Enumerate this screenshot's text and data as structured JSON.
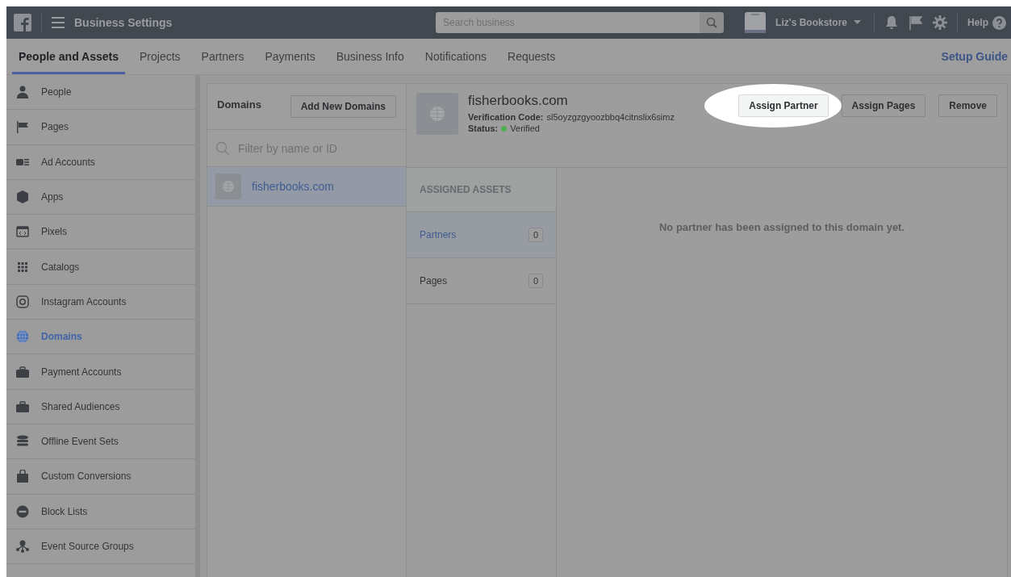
{
  "top_bar": {
    "title": "Business Settings",
    "search": {
      "placeholder": "Search business"
    },
    "account": "Liz's Bookstore",
    "help": "Help"
  },
  "tabs": [
    {
      "label": "People and Assets",
      "selected": true
    },
    {
      "label": "Projects",
      "selected": false
    },
    {
      "label": "Partners",
      "selected": false
    },
    {
      "label": "Payments",
      "selected": false
    },
    {
      "label": "Business Info",
      "selected": false
    },
    {
      "label": "Notifications",
      "selected": false
    },
    {
      "label": "Requests",
      "selected": false
    }
  ],
  "setup_guide": "Setup Guide",
  "sidebar": {
    "items": [
      {
        "label": "People",
        "selected": false
      },
      {
        "label": "Pages",
        "selected": false
      },
      {
        "label": "Ad Accounts",
        "selected": false
      },
      {
        "label": "Apps",
        "selected": false
      },
      {
        "label": "Pixels",
        "selected": false
      },
      {
        "label": "Catalogs",
        "selected": false
      },
      {
        "label": "Instagram Accounts",
        "selected": false
      },
      {
        "label": "Domains",
        "selected": true
      },
      {
        "label": "Payment Accounts",
        "selected": false
      },
      {
        "label": "Shared Audiences",
        "selected": false
      },
      {
        "label": "Offline Event Sets",
        "selected": false
      },
      {
        "label": "Custom Conversions",
        "selected": false
      },
      {
        "label": "Block Lists",
        "selected": false
      },
      {
        "label": "Event Source Groups",
        "selected": false
      }
    ]
  },
  "domains_panel": {
    "title": "Domains",
    "add_button": "Add New Domains",
    "filter": {
      "placeholder": "Filter by name or ID"
    },
    "items": [
      {
        "name": "fisherbooks.com",
        "selected": true
      }
    ]
  },
  "domain_detail": {
    "name": "fisherbooks.com",
    "verification_label": "Verification Code:",
    "verification_code": "sl5oyzgzgyoozbbq4citnslix6simz",
    "status_label": "Status:",
    "status": "Verified",
    "buttons": [
      {
        "label": "Assign Partner",
        "highlighted": true
      },
      {
        "label": "Assign Pages",
        "highlighted": false
      },
      {
        "label": "Remove",
        "highlighted": false
      }
    ],
    "assets_heading": "ASSIGNED ASSETS",
    "assets": [
      {
        "label": "Partners",
        "count": "0",
        "selected": true
      },
      {
        "label": "Pages",
        "count": "0",
        "selected": false
      }
    ],
    "empty_message": "No partner has been assigned to this domain yet."
  }
}
